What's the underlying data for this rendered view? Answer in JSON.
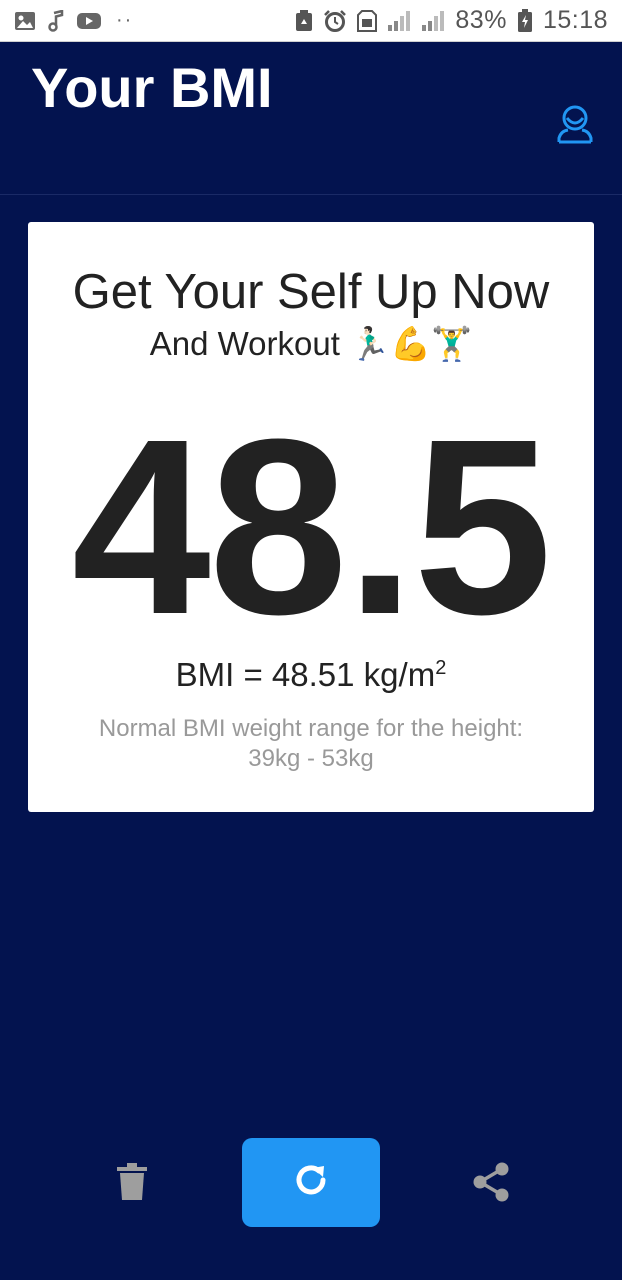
{
  "status_bar": {
    "battery_percent": "83%",
    "time": "15:18",
    "dots": "··",
    "icons": [
      "gallery-icon",
      "music-note-icon",
      "youtube-icon",
      "recycle-icon",
      "alarm-icon",
      "sim-icon",
      "signal-icon",
      "signal-icon",
      "battery-charging-icon"
    ]
  },
  "header": {
    "title": "Your BMI",
    "account_icon": "user-profile-icon"
  },
  "result_card": {
    "headline": "Get Your Self Up Now",
    "subline": "And Workout 🏃🏻‍♂️💪🏋️‍♂️",
    "bmi_value": "48.5",
    "bmi_label": "BMI = 48.51 kg/m",
    "bmi_unit_exponent": "2",
    "range_label": "Normal BMI weight range for the height:",
    "range_value": "39kg - 53kg"
  },
  "actions": {
    "delete_icon": "trash-icon",
    "refresh_icon": "refresh-icon",
    "share_icon": "share-icon"
  },
  "colors": {
    "background": "#03134f",
    "accent": "#2196f3",
    "card": "#ffffff",
    "icon_grey": "#9e9e9e"
  }
}
